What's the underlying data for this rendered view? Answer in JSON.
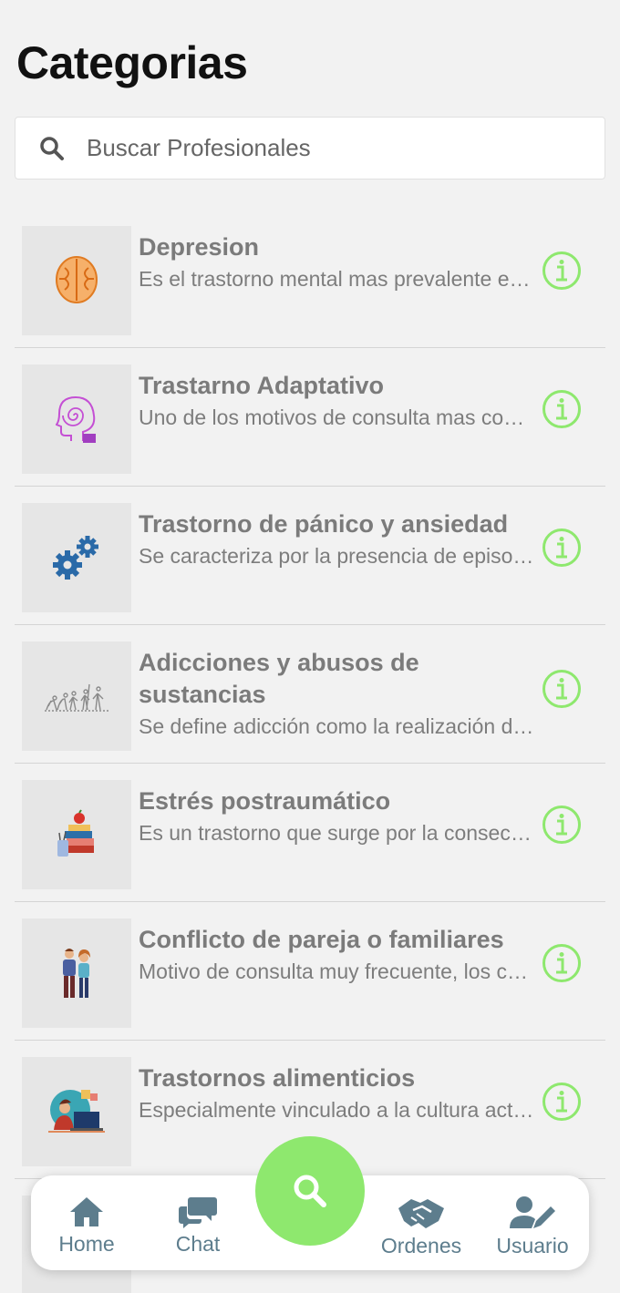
{
  "header": {
    "title": "Categorias"
  },
  "search": {
    "placeholder": "Buscar Profesionales"
  },
  "categories": [
    {
      "title": "Depresion",
      "description": "Es el trastorno mental mas prevalente en la población",
      "icon": "brain-icon"
    },
    {
      "title": "Trastarno Adaptativo",
      "description": "Uno de los motivos de consulta mas comunes",
      "icon": "head-spiral-icon"
    },
    {
      "title": "Trastorno de pánico y ansiedad",
      "description": "Se caracteriza por la presencia de episodios",
      "icon": "gears-icon"
    },
    {
      "title": "Adicciones y abusos de sustancias",
      "description": "Se define adicción como la realización de conductas",
      "icon": "evolution-icon"
    },
    {
      "title": "Estrés postraumático",
      "description": "Es un trastorno que surge por la consecuencia",
      "icon": "books-apple-icon"
    },
    {
      "title": "Conflicto de pareja o familiares",
      "description": "Motivo de consulta muy frecuente, los conflictos",
      "icon": "couple-icon"
    },
    {
      "title": "Trastornos alimenticios",
      "description": "Especialmente vinculado a la cultura actual",
      "icon": "person-laptop-icon"
    }
  ],
  "nav": {
    "home": "Home",
    "chat": "Chat",
    "orders": "Ordenes",
    "user": "Usuario"
  },
  "colors": {
    "accent": "#8ee86e",
    "nav_icon": "#5d7d8d",
    "background": "#f2f2f2"
  }
}
